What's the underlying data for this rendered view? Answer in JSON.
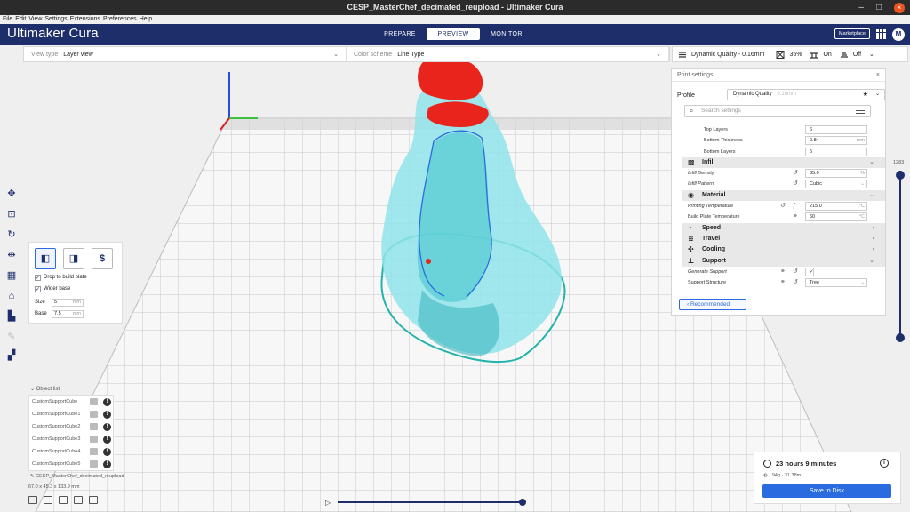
{
  "window": {
    "title": "CESP_MasterChef_decimated_reupload - Ultimaker Cura",
    "minimize": "–",
    "maximize": "□",
    "close": "×"
  },
  "menu": [
    "File",
    "Edit",
    "View",
    "Settings",
    "Extensions",
    "Preferences",
    "Help"
  ],
  "header": {
    "logo": "Ultimaker Cura",
    "stages": [
      "PREPARE",
      "PREVIEW",
      "MONITOR"
    ],
    "active_stage": "PREVIEW",
    "marketplace": "Marketplace",
    "avatar": "M"
  },
  "viewbar": {
    "view_type_label": "View type",
    "view_type_value": "Layer view",
    "color_scheme_label": "Color scheme",
    "color_scheme_value": "Line Type"
  },
  "quality": {
    "profile": "Dynamic Quality - 0.16mm",
    "infill": "35%",
    "support": "On",
    "adhesion": "Off"
  },
  "print_settings": {
    "title": "Print settings",
    "profile_label": "Profile",
    "profile_value": "Dynamic Quality",
    "profile_hint": "0.16mm",
    "search_placeholder": "Search settings",
    "rows": [
      {
        "kind": "setting",
        "name": "Top Layers",
        "value": "6",
        "unit": ""
      },
      {
        "kind": "setting",
        "name": "Bottom Thickness",
        "value": "0.84",
        "unit": "mm"
      },
      {
        "kind": "setting",
        "name": "Bottom Layers",
        "value": "6",
        "unit": ""
      },
      {
        "kind": "category",
        "name": "Infill"
      },
      {
        "kind": "setting",
        "name": "Infill Density",
        "value": "35.0",
        "unit": "%"
      },
      {
        "kind": "setting",
        "name": "Infill Pattern",
        "value": "Cubic",
        "unit": ""
      },
      {
        "kind": "category",
        "name": "Material"
      },
      {
        "kind": "setting",
        "name": "Printing Temperature",
        "value": "215.0",
        "unit": "°C"
      },
      {
        "kind": "setting",
        "name": "Build Plate Temperature",
        "value": "60",
        "unit": "°C"
      },
      {
        "kind": "category",
        "name": "Speed"
      },
      {
        "kind": "category",
        "name": "Travel"
      },
      {
        "kind": "category",
        "name": "Cooling"
      },
      {
        "kind": "category",
        "name": "Support"
      },
      {
        "kind": "setting",
        "name": "Generate Support",
        "value": "✓",
        "unit": ""
      },
      {
        "kind": "setting",
        "name": "Support Structure",
        "value": "Tree",
        "unit": ""
      }
    ],
    "recommended_btn": "Recommended"
  },
  "support_panel": {
    "drop_to_plate": "Drop to build plate",
    "wider_base": "Wider base",
    "size_label": "Size",
    "size_value": "5",
    "size_unit": "mm",
    "base_label": "Base",
    "base_value": "7.5",
    "base_unit": "mm",
    "btn_dollar": "$"
  },
  "object_list": {
    "title": "Object list",
    "items": [
      "CustomSupportCube",
      "CustomSupportCube1",
      "CustomSupportCube2",
      "CustomSupportCube3",
      "CustomSupportCube4",
      "CustomSupportCube5"
    ],
    "filename": "CESP_MasterChef_decimated_reupload",
    "dimensions": "67.0 x 45.3 x 133.9 mm"
  },
  "layer_slider": {
    "top_value": "1283"
  },
  "output": {
    "time": "23 hours 9 minutes",
    "material": "94g · 31.38m",
    "save_btn": "Save to Disk"
  },
  "colors": {
    "header_bg": "#1d2e6b",
    "accent": "#2a6be0",
    "model_cyan": "#7fe0e8",
    "support_red": "#e8241c"
  }
}
